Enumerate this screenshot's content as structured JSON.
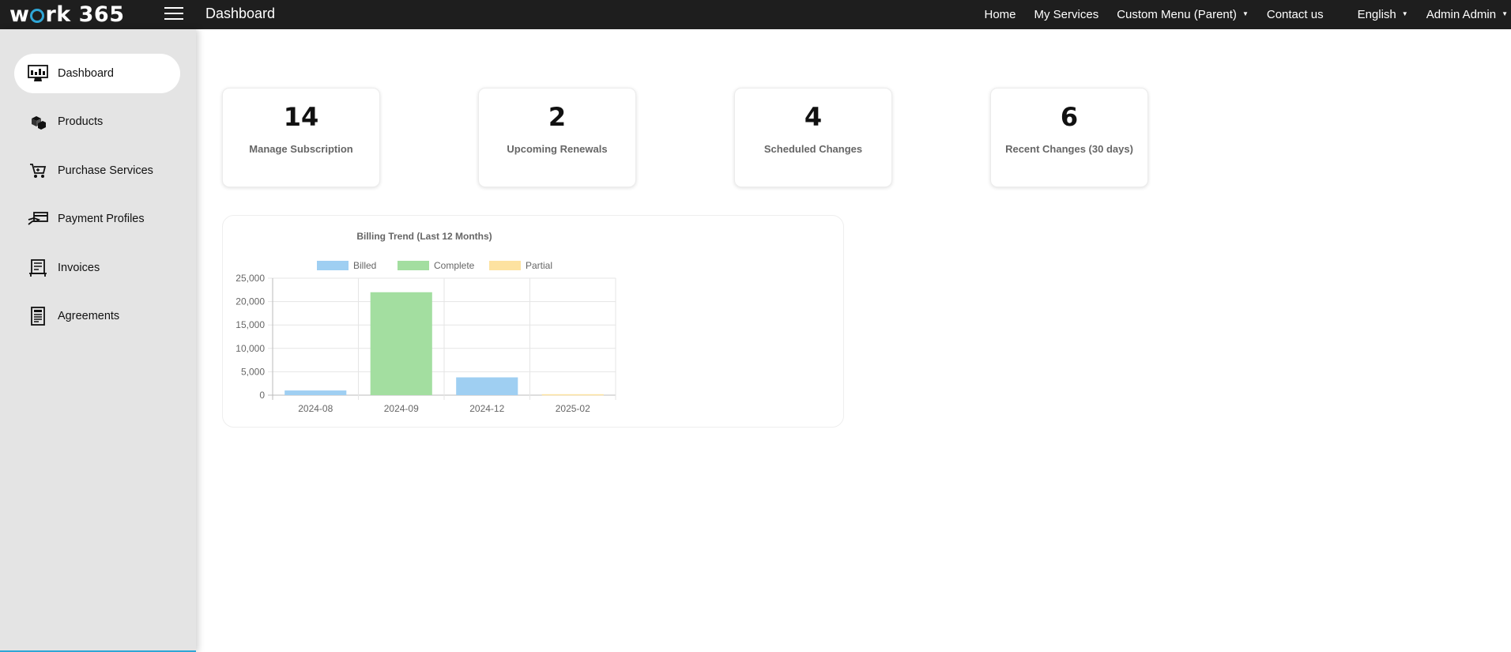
{
  "header": {
    "logo_text": "work365",
    "page_title": "Dashboard",
    "nav": [
      {
        "label": "Home"
      },
      {
        "label": "My Services"
      },
      {
        "label": "Custom Menu (Parent)",
        "has_dropdown": true
      },
      {
        "label": "Contact us"
      }
    ],
    "language": "English",
    "user": "Admin Admin"
  },
  "sidebar": {
    "items": [
      {
        "label": "Dashboard",
        "icon": "dashboard-icon",
        "active": true
      },
      {
        "label": "Products",
        "icon": "products-icon"
      },
      {
        "label": "Purchase Services",
        "icon": "cart-icon"
      },
      {
        "label": "Payment Profiles",
        "icon": "payment-icon"
      },
      {
        "label": "Invoices",
        "icon": "invoice-icon"
      },
      {
        "label": "Agreements",
        "icon": "agreement-icon"
      }
    ]
  },
  "cards": [
    {
      "value": "14",
      "label": "Manage Subscription"
    },
    {
      "value": "2",
      "label": "Upcoming Renewals"
    },
    {
      "value": "4",
      "label": "Scheduled Changes"
    },
    {
      "value": "6",
      "label": "Recent Changes (30 days)"
    }
  ],
  "chart_data": {
    "type": "bar",
    "title": "Billing Trend (Last 12 Months)",
    "categories": [
      "2024-08",
      "2024-09",
      "2024-12",
      "2025-02"
    ],
    "series": [
      {
        "name": "Billed",
        "values": [
          1000,
          0,
          3800,
          0
        ],
        "color": "#9fcff2"
      },
      {
        "name": "Complete",
        "values": [
          0,
          22000,
          0,
          0
        ],
        "color": "#a3dea0"
      },
      {
        "name": "Partial",
        "values": [
          0,
          0,
          0,
          200
        ],
        "color": "#fde2a0"
      }
    ],
    "ylim": [
      0,
      25000
    ],
    "yticks": [
      "0",
      "5,000",
      "10,000",
      "15,000",
      "20,000",
      "25,000"
    ],
    "legend": "top",
    "stacked": true,
    "grid": true
  }
}
